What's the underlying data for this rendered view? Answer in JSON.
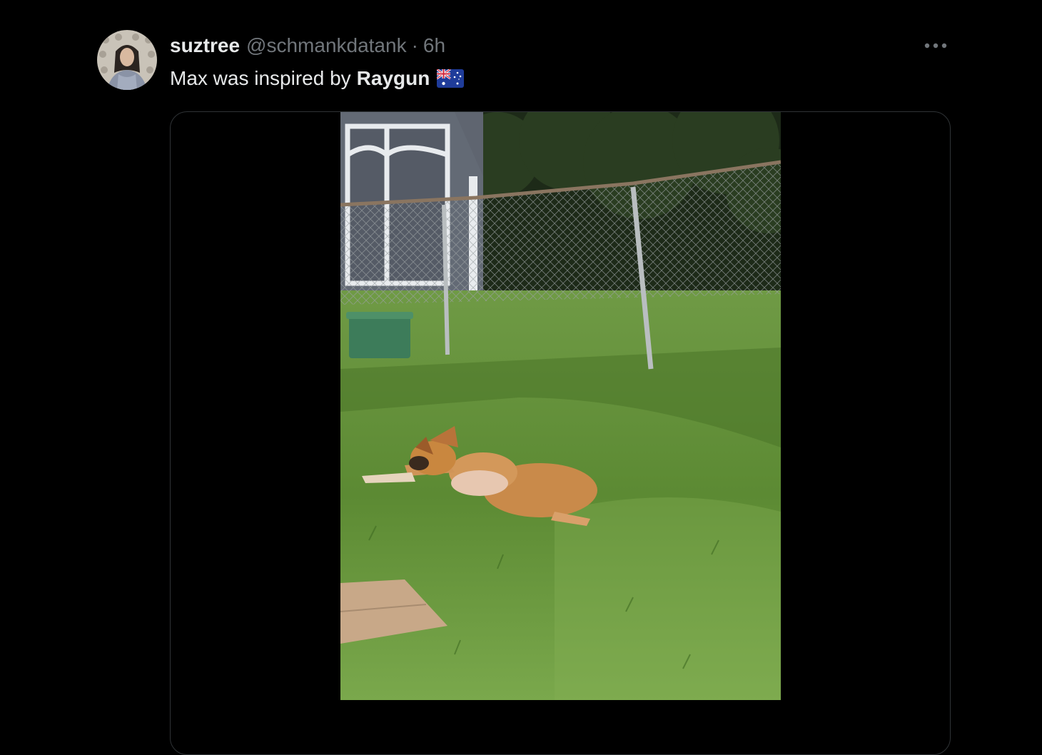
{
  "tweet": {
    "display_name": "suztree",
    "handle": "@schmankdatank",
    "separator": "·",
    "time": "6h",
    "text_prefix": "Max was inspired by",
    "mention": "Raygun",
    "emoji": "australia-flag-emoji"
  },
  "icons": {
    "more": "more-horizontal-icon",
    "avatar": "profile-picture"
  },
  "colors": {
    "background": "#000000",
    "primary_text": "#e7e9ea",
    "secondary_text": "#71767b",
    "border": "#2f3336"
  },
  "media": {
    "type": "video",
    "subject": "dog rolling on grass in backyard"
  }
}
